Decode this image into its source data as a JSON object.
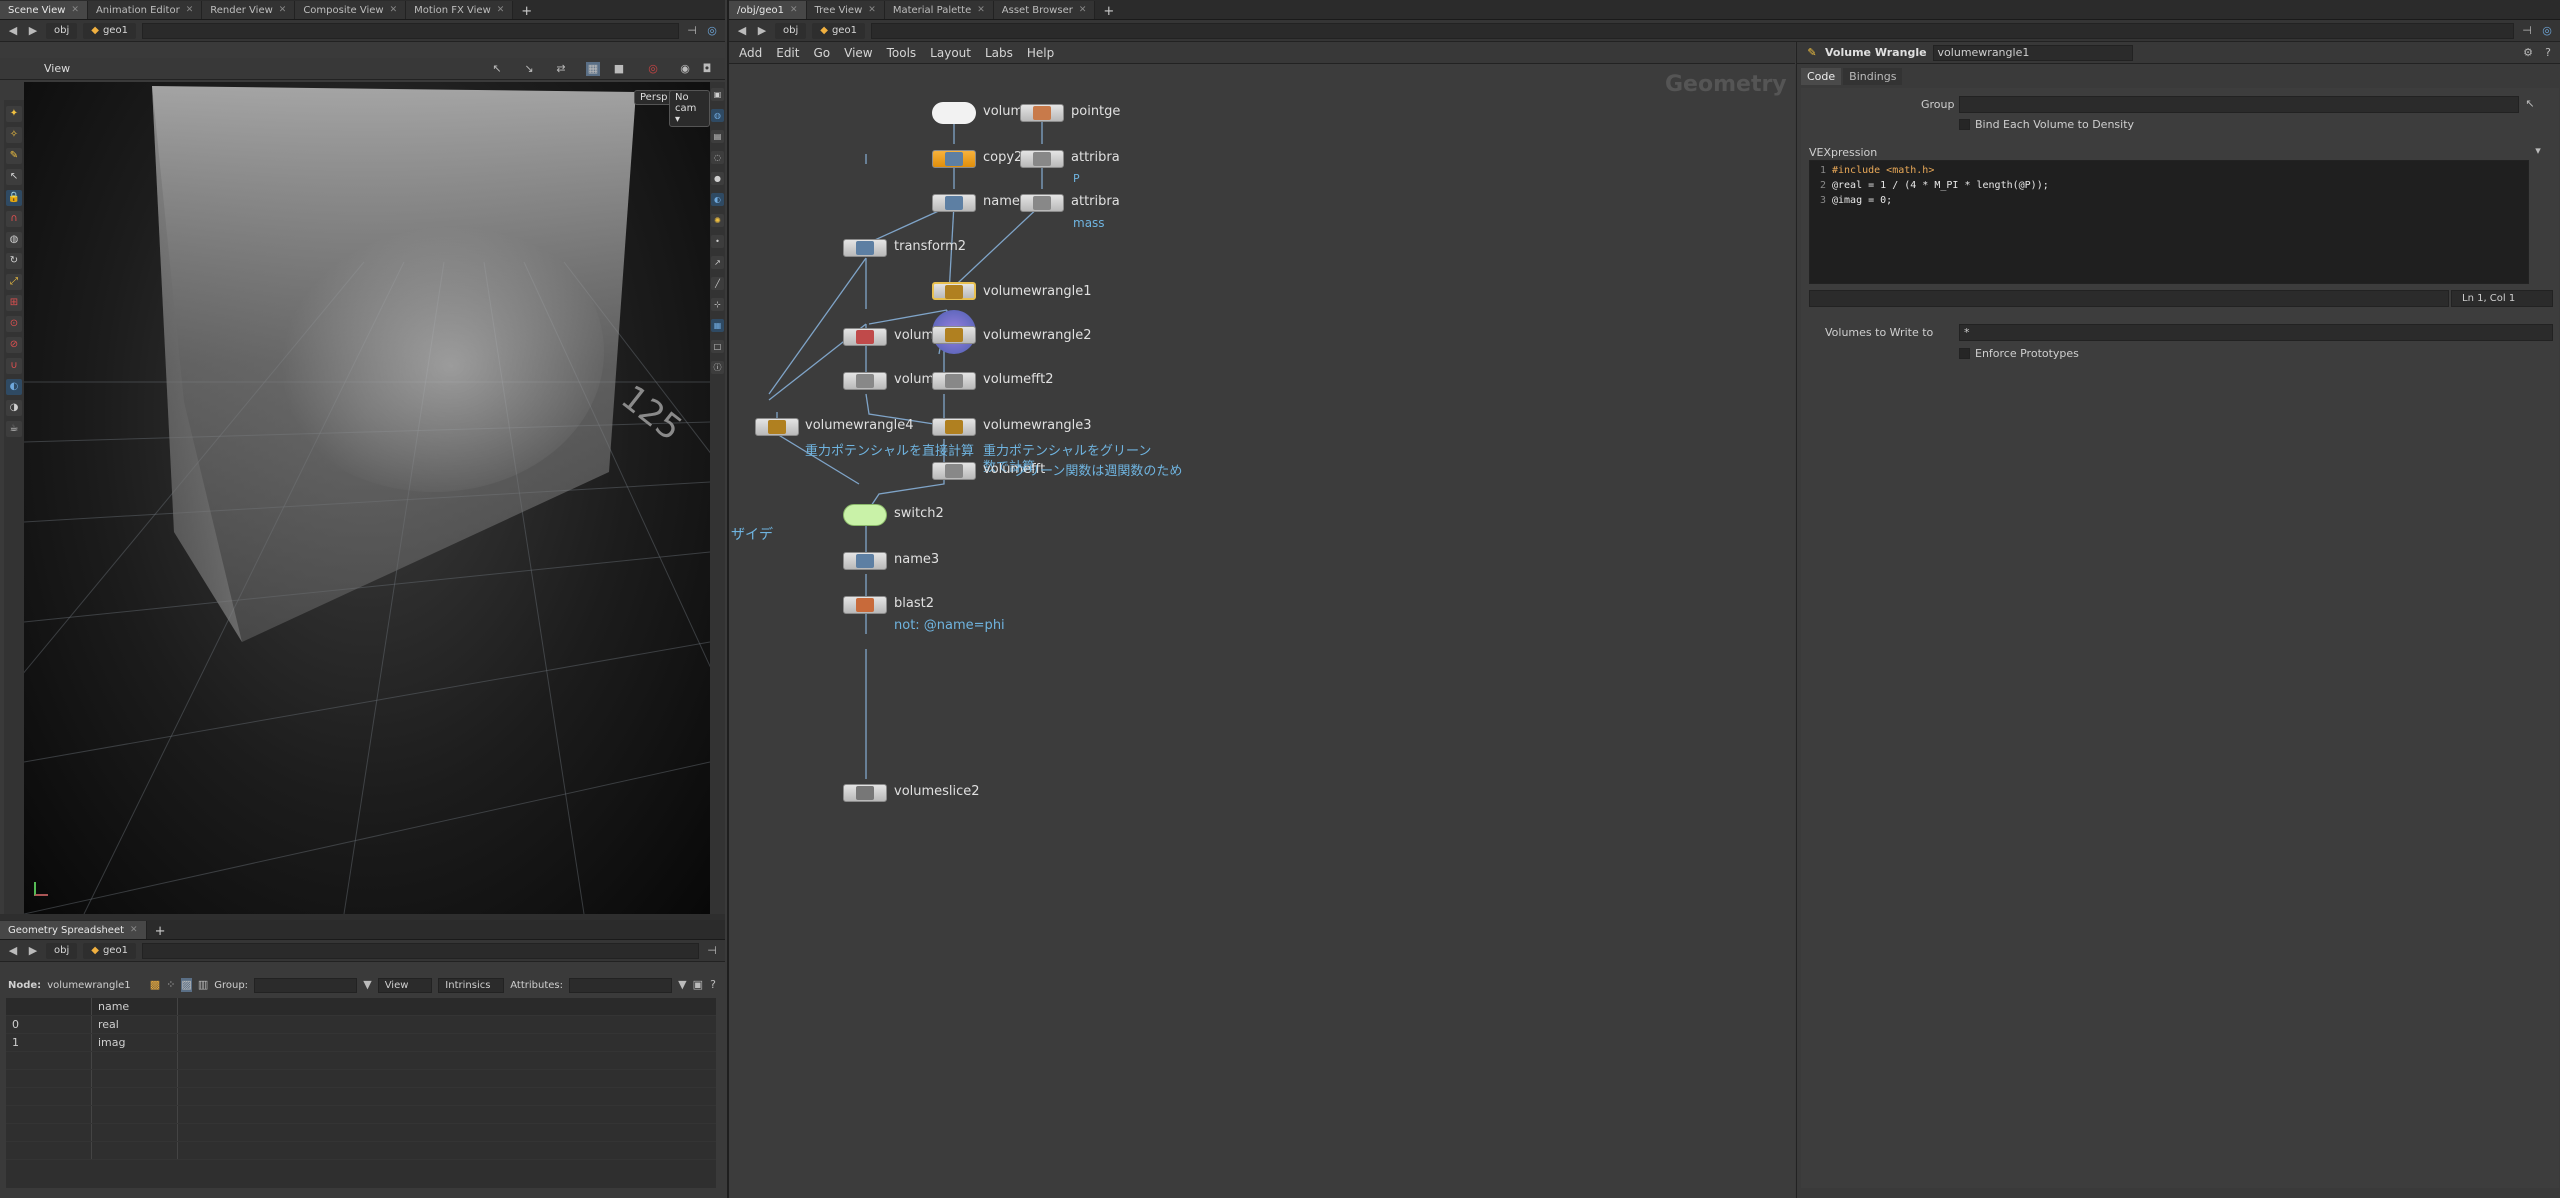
{
  "left_tabs": [
    {
      "label": "Scene View",
      "active": true
    },
    {
      "label": "Animation Editor"
    },
    {
      "label": "Render View"
    },
    {
      "label": "Composite View"
    },
    {
      "label": "Motion FX View"
    }
  ],
  "right_tabs": [
    {
      "label": "/obj/geo1",
      "active": true
    },
    {
      "label": "Tree View"
    },
    {
      "label": "Material Palette"
    },
    {
      "label": "Asset Browser"
    }
  ],
  "left_path": {
    "obj": "obj",
    "geo": "geo1"
  },
  "right_path": {
    "obj": "obj",
    "geo": "geo1"
  },
  "viewport": {
    "title": "View",
    "persp": "Persp ▾",
    "cam": "No cam ▾",
    "grid_label": "125"
  },
  "spreadsheet": {
    "tab": "Geometry Spreadsheet",
    "path": {
      "obj": "obj",
      "geo": "geo1"
    },
    "node_label": "Node:",
    "node_value": "volumewrangle1",
    "group_label": "Group:",
    "view_label": "View",
    "intrinsics_label": "Intrinsics",
    "attributes_label": "Attributes:",
    "col_header": "name",
    "rows": [
      {
        "idx": "0",
        "name": "real"
      },
      {
        "idx": "1",
        "name": "imag"
      }
    ]
  },
  "network": {
    "menu": [
      "Add",
      "Edit",
      "Go",
      "View",
      "Tools",
      "Layout",
      "Labs",
      "Help"
    ],
    "watermark": "Geometry",
    "nodes": {
      "volume2": "volume2",
      "pointgen": "pointge",
      "copy2": "copy2",
      "attrib1": "attribra",
      "attrib1_comment": "P",
      "name2": "name2",
      "attrib2": "attribra",
      "attrib2_comment": "mass",
      "transform2": "transform2",
      "vw1": "volumewrangle1",
      "volumefrom": "volumefro",
      "vw2": "volumewrangle2",
      "volumefft": "volumefft",
      "volumefft2": "volumefft2",
      "vw4": "volumewrangle4",
      "vw4_comment": "重力ポテンシャルを直接計算",
      "vw3": "volumewrangle3",
      "vw3_comment": "重力ポテンシャルをグリーン",
      "vw3_comment2": "数で計算",
      "volumefft3": "volumefft",
      "vw3_comment3": "グリーン関数は週関数のため",
      "switch2": "switch2",
      "name3": "name3",
      "blast2": "blast2",
      "blast2_comment": "not: @name=phi",
      "volumeslice2": "volumeslice2",
      "side_note": "ザイデ"
    }
  },
  "params": {
    "node_type": "Volume Wrangle",
    "node_name": "volumewrangle1",
    "tabs": [
      {
        "label": "Code",
        "active": true
      },
      {
        "label": "Bindings"
      }
    ],
    "group_label": "Group",
    "bind_label": "Bind Each Volume to Density",
    "vex_label": "VEXpression",
    "code_lines": [
      {
        "n": "1",
        "t": "#include <math.h>"
      },
      {
        "n": "2",
        "t": "@real = 1 / (4 * M_PI * length(@P));"
      },
      {
        "n": "3",
        "t": "@imag = 0;"
      }
    ],
    "cursor": "Ln 1, Col 1",
    "write_label": "Volumes to Write to",
    "write_value": "*",
    "enforce_label": "Enforce Prototypes"
  }
}
